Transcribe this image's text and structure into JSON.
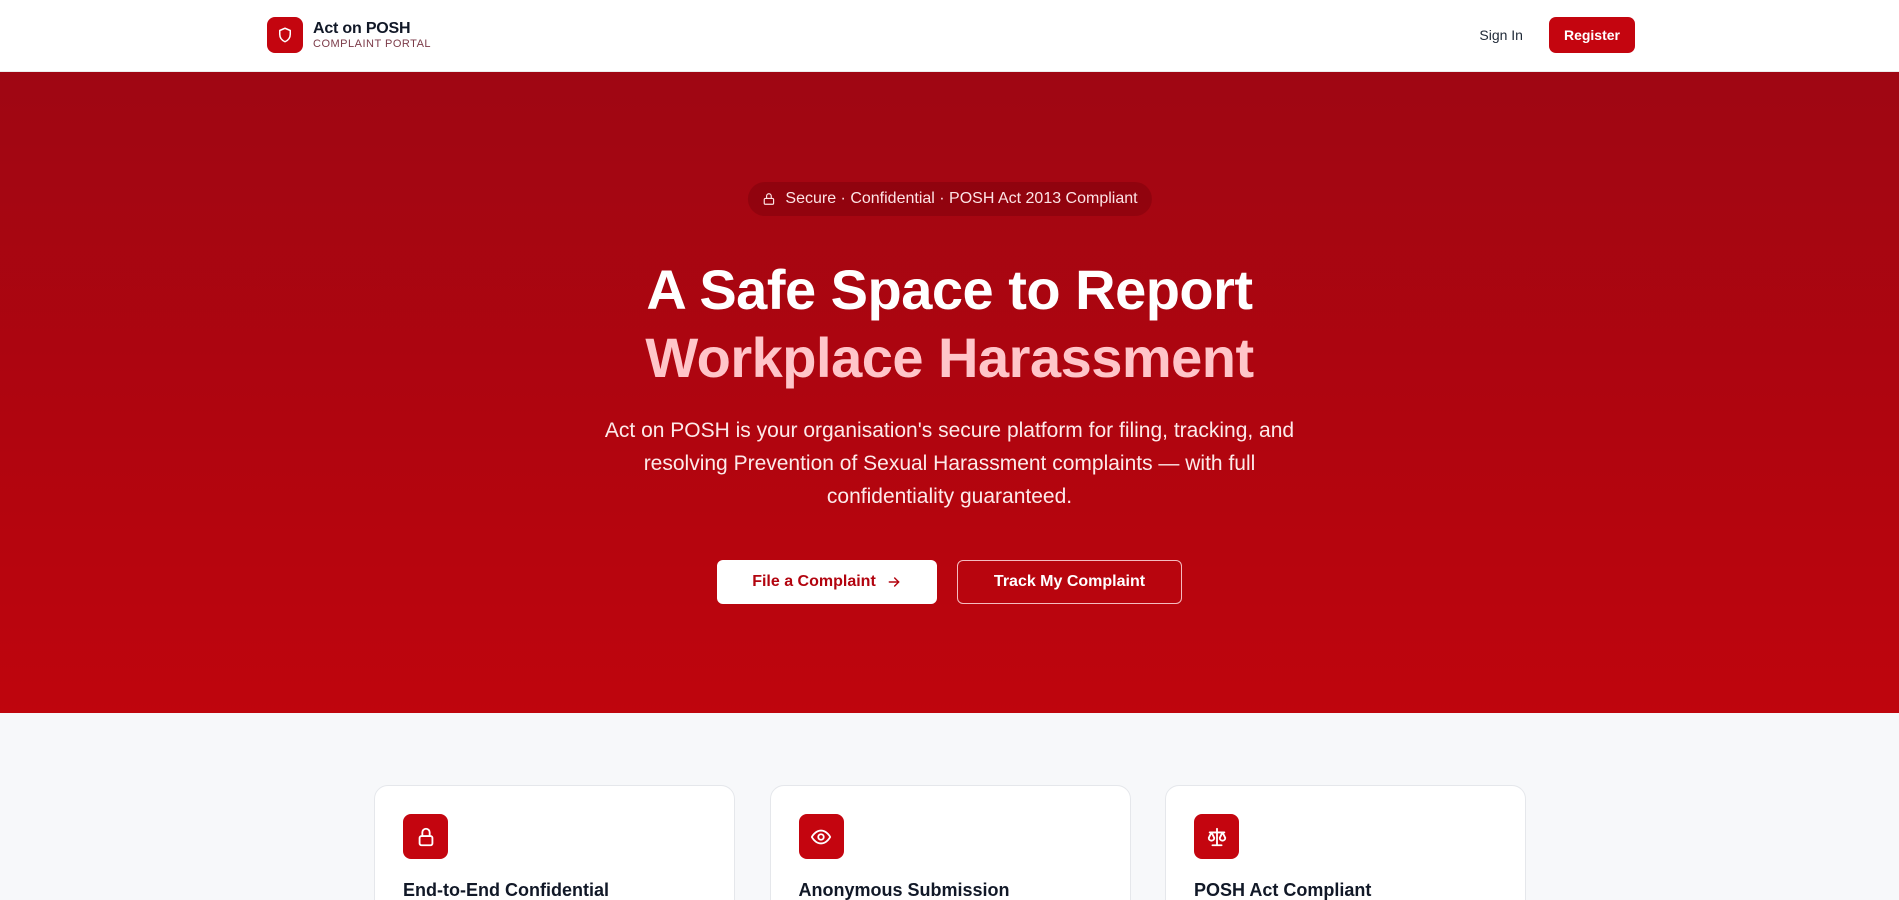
{
  "header": {
    "brand_title": "Act on POSH",
    "brand_subtitle": "COMPLAINT PORTAL",
    "brand_icon": "shield-icon",
    "signin_label": "Sign In",
    "register_label": "Register"
  },
  "hero": {
    "badge": "Secure · Confidential · POSH Act 2013 Compliant",
    "badge_icon": "lock-icon",
    "headline_line1": "A Safe Space to Report",
    "headline_line2": "Workplace Harassment",
    "lead": "Act on POSH is your organisation's secure platform for filing, tracking, and resolving Prevention of Sexual Harassment complaints — with full confidentiality guaranteed.",
    "primary_cta": "File a Complaint",
    "secondary_cta": "Track My Complaint"
  },
  "features": [
    {
      "icon": "lock-icon",
      "title": "End-to-End Confidential"
    },
    {
      "icon": "eye-icon",
      "title": "Anonymous Submission"
    },
    {
      "icon": "scale-icon",
      "title": "POSH Act Compliant"
    }
  ],
  "colors": {
    "brand_red": "#c4050f",
    "hero_top": "#9f0613",
    "hero_bottom": "#bf050d",
    "headline_accent": "#ffc5c9",
    "page_bg": "#f7f8fa"
  }
}
